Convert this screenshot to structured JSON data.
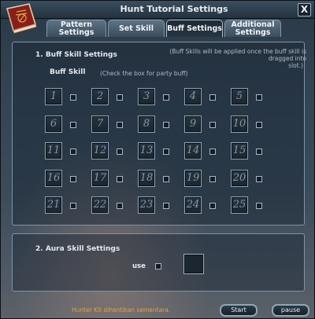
{
  "window": {
    "title": "Hunt Tutorial Settings",
    "close_glyph": "X",
    "book_icon": "book-icon"
  },
  "tabs": [
    {
      "label_line1": "Pattern",
      "label_line2": "Settings",
      "active": false
    },
    {
      "label_line1": "Set Skill",
      "label_line2": "",
      "active": false
    },
    {
      "label_line1": "Buff Settings",
      "label_line2": "",
      "active": true
    },
    {
      "label_line1": "Additional",
      "label_line2": "Settings",
      "active": false
    }
  ],
  "buff": {
    "heading": "1. Buff Skill Settings",
    "note_line1": "(Buff Skills will be applied once the buff skill is dragged into",
    "note_line2": "slot.)",
    "subheading": "Buff Skill",
    "party_note": "(Check the box for party buff)",
    "slots": [
      "1",
      "2",
      "3",
      "4",
      "5",
      "6",
      "7",
      "8",
      "9",
      "10",
      "11",
      "12",
      "13",
      "14",
      "15",
      "16",
      "17",
      "18",
      "19",
      "20",
      "21",
      "22",
      "23",
      "24",
      "25"
    ]
  },
  "aura": {
    "heading": "2. Aura Skill Settings",
    "use_label": "use"
  },
  "status_text": "Hunter Kit dihentikan sementara.",
  "buttons": {
    "start": "Start",
    "pause": "pause"
  },
  "colors": {
    "status": "#e5a13a",
    "panel_border": "#7d93a3"
  }
}
